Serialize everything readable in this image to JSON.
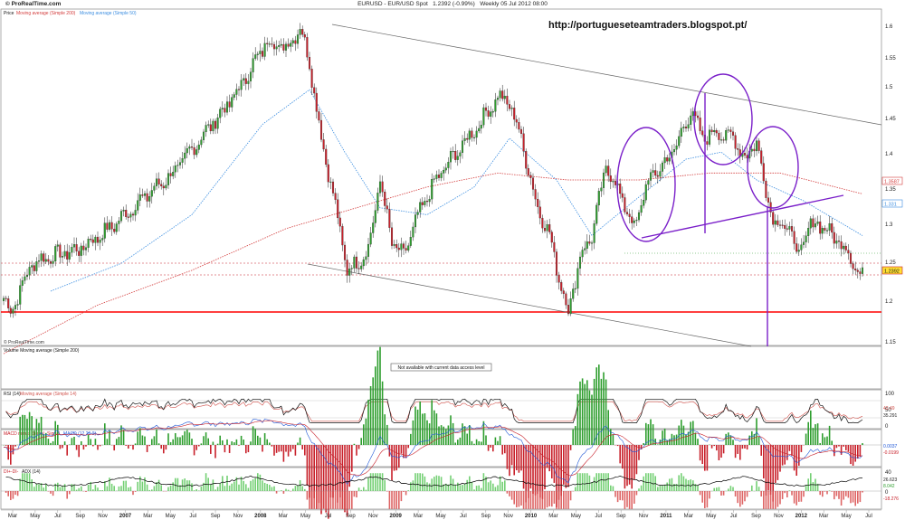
{
  "header": {
    "logo": "© ProRealTime.com",
    "instrument": "EURUSD - EUR/USD Spot",
    "last_change": "1.2392 (-0.99%)",
    "timeframe": "Weekly  05 Jul 2012 08:00",
    "blog_url": "http://portugueseteamtraders.blogspot.pt/"
  },
  "colors": {
    "up_candle": "#2e9e2e",
    "down_candle": "#c8202a",
    "sma200": "#d33b3b",
    "sma50": "#3a8de0",
    "pattern": "#7a1fc9",
    "support": "#ff0000",
    "channel": "#555555",
    "rsi_ma": "#d0504a",
    "macd_line": "#1f57d6",
    "signal_line": "#c8202a",
    "adx_line": "#000000"
  },
  "chart_data": [
    {
      "type": "candlestick",
      "title": "Price  Moving average (Simple 200)  Moving average (Simple 50)",
      "legend": [
        "Price",
        "Moving average (Simple 200)",
        "Moving average (Simple 50)"
      ],
      "watermark": "© ProRealTime.com",
      "y_ticks": [
        "1.6",
        "1.55",
        "1.5",
        "1.45",
        "1.4",
        "1.35",
        "1.3",
        "1.25",
        "1.2",
        "1.15"
      ],
      "ylim": [
        1.15,
        1.62
      ],
      "price_labels": {
        "sma200": "1.3587",
        "sma50": "1.331",
        "last": "1.2392"
      },
      "x_labels": [
        "Mar",
        "May",
        "Jul",
        "Sep",
        "Nov",
        "2007",
        "Mar",
        "May",
        "Jul",
        "Sep",
        "Nov",
        "2008",
        "Mar",
        "May",
        "Jul",
        "Sep",
        "Nov",
        "2009",
        "Mar",
        "May",
        "Jul",
        "Sep",
        "Nov",
        "2010",
        "Mar",
        "May",
        "Jul",
        "Sep",
        "Nov",
        "2011",
        "Mar",
        "May",
        "Jul",
        "Sep",
        "Nov",
        "2012",
        "Mar",
        "May",
        "Jul"
      ],
      "close_anchors": [
        [
          0,
          1.21
        ],
        [
          3,
          1.19
        ],
        [
          12,
          1.26
        ],
        [
          20,
          1.27
        ],
        [
          32,
          1.28
        ],
        [
          45,
          1.31
        ],
        [
          58,
          1.35
        ],
        [
          72,
          1.39
        ],
        [
          86,
          1.45
        ],
        [
          98,
          1.5
        ],
        [
          105,
          1.54
        ],
        [
          112,
          1.58
        ],
        [
          120,
          1.57
        ],
        [
          126,
          1.6
        ],
        [
          130,
          1.55
        ],
        [
          135,
          1.44
        ],
        [
          140,
          1.36
        ],
        [
          146,
          1.25
        ],
        [
          150,
          1.26
        ],
        [
          155,
          1.28
        ],
        [
          160,
          1.38
        ],
        [
          165,
          1.29
        ],
        [
          170,
          1.27
        ],
        [
          175,
          1.32
        ],
        [
          182,
          1.37
        ],
        [
          188,
          1.4
        ],
        [
          195,
          1.43
        ],
        [
          202,
          1.46
        ],
        [
          210,
          1.5
        ],
        [
          215,
          1.49
        ],
        [
          220,
          1.44
        ],
        [
          226,
          1.35
        ],
        [
          232,
          1.3
        ],
        [
          236,
          1.24
        ],
        [
          240,
          1.19
        ],
        [
          245,
          1.27
        ],
        [
          250,
          1.3
        ],
        [
          256,
          1.4
        ],
        [
          262,
          1.36
        ],
        [
          268,
          1.31
        ],
        [
          274,
          1.38
        ],
        [
          280,
          1.4
        ],
        [
          286,
          1.43
        ],
        [
          292,
          1.48
        ],
        [
          297,
          1.44
        ],
        [
          302,
          1.45
        ],
        [
          310,
          1.44
        ],
        [
          316,
          1.41
        ],
        [
          320,
          1.44
        ],
        [
          324,
          1.36
        ],
        [
          328,
          1.32
        ],
        [
          334,
          1.31
        ],
        [
          338,
          1.27
        ],
        [
          342,
          1.31
        ],
        [
          346,
          1.32
        ],
        [
          352,
          1.3
        ],
        [
          356,
          1.29
        ],
        [
          360,
          1.27
        ],
        [
          364,
          1.24
        ]
      ],
      "sma50_anchors": [
        [
          20,
          1.22
        ],
        [
          50,
          1.26
        ],
        [
          80,
          1.33
        ],
        [
          110,
          1.46
        ],
        [
          130,
          1.51
        ],
        [
          145,
          1.42
        ],
        [
          160,
          1.34
        ],
        [
          180,
          1.33
        ],
        [
          200,
          1.37
        ],
        [
          215,
          1.44
        ],
        [
          235,
          1.38
        ],
        [
          250,
          1.3
        ],
        [
          268,
          1.35
        ],
        [
          290,
          1.41
        ],
        [
          305,
          1.42
        ],
        [
          320,
          1.38
        ],
        [
          340,
          1.35
        ],
        [
          365,
          1.3
        ]
      ],
      "sma200_anchors": [
        [
          0,
          1.13
        ],
        [
          40,
          1.2
        ],
        [
          80,
          1.25
        ],
        [
          120,
          1.31
        ],
        [
          150,
          1.34
        ],
        [
          180,
          1.37
        ],
        [
          210,
          1.39
        ],
        [
          240,
          1.38
        ],
        [
          270,
          1.38
        ],
        [
          300,
          1.39
        ],
        [
          330,
          1.39
        ],
        [
          365,
          1.36
        ]
      ]
    },
    {
      "type": "bar",
      "title": "Volume  Moving average (Simple 200)",
      "notice": "Not available with current data access level"
    },
    {
      "type": "line",
      "title": "RSI (14)  Moving average (Simple 14)",
      "legend": [
        "RSI (14)",
        "Moving average (Simple 14)"
      ],
      "y_ticks": [
        "100",
        "50",
        "0"
      ],
      "value_labels": [
        "35.291",
        "42.49"
      ],
      "ylim": [
        0,
        100
      ]
    },
    {
      "type": "bar",
      "title": "MACD minus Signal  Signal MACD (12 26 9)",
      "legend": [
        "MACD minus Signal",
        "Signal",
        "MACD (12 26 9)"
      ],
      "value_labels": [
        "0.0037",
        "-0.0199"
      ]
    },
    {
      "type": "bar",
      "title": "DI+-DI-  ADX (14)",
      "legend": [
        "DI+-DI-",
        "ADX (14)"
      ],
      "y_ticks": [
        "40",
        "0"
      ],
      "value_labels": [
        "26.623",
        "8.042",
        "-18.276"
      ]
    }
  ]
}
